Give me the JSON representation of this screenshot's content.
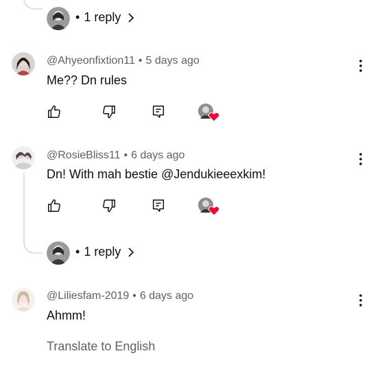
{
  "top_reply": {
    "label": "1 reply"
  },
  "comments": [
    {
      "author": "@Ahyeonfixtion11",
      "time": "5 days ago",
      "text": "Me?? Dn rules"
    },
    {
      "author": "@RosieBliss11",
      "time": "6 days ago",
      "text": "Dn! With mah bestie @Jendukieeexkim!",
      "reply_label": "1 reply"
    },
    {
      "author": "@Liliesfam-2019",
      "time": "6 days ago",
      "text": "Ahmm!",
      "translate": "Translate to English"
    }
  ],
  "separator": "•",
  "colors": {
    "heart": "#ff0033",
    "meta": "#606060",
    "thread": "#e0e0e0"
  },
  "icons": [
    "like-icon",
    "dislike-icon",
    "reply-icon",
    "creator-heart-icon",
    "more-vert-icon",
    "chevron-right-icon"
  ]
}
